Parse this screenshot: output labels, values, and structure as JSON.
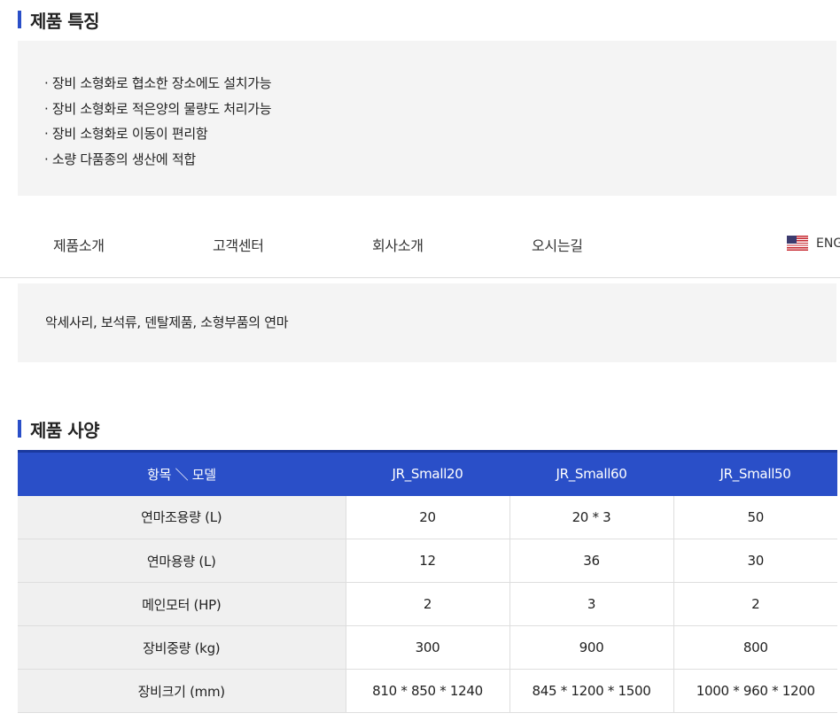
{
  "features": {
    "title": "제품 특징",
    "items": [
      "· 장비 소형화로 협소한 장소에도 설치가능",
      "· 장비 소형화로 적은양의 물량도 처리가능",
      "· 장비 소형화로 이동이 편리함",
      "· 소량 다품종의 생산에 적합"
    ]
  },
  "nav": {
    "items": [
      "제품소개",
      "고객센터",
      "회사소개",
      "오시는길"
    ],
    "language": "ENG"
  },
  "usage": {
    "text": "악세사리, 보석류, 덴탈제품, 소형부품의 연마"
  },
  "specs": {
    "title": "제품 사양",
    "header": [
      "항목 ＼ 모델",
      "JR_Small20",
      "JR_Small60",
      "JR_Small50"
    ],
    "rows": [
      [
        "연마조용량 (L)",
        "20",
        "20 * 3",
        "50"
      ],
      [
        "연마용량 (L)",
        "12",
        "36",
        "30"
      ],
      [
        "메인모터 (HP)",
        "2",
        "3",
        "2"
      ],
      [
        "장비중량 (kg)",
        "300",
        "900",
        "800"
      ],
      [
        "장비크기 (mm)",
        "810 * 850 * 1240",
        "845 * 1200 * 1500",
        "1000 * 960 * 1200"
      ]
    ]
  },
  "colors": {
    "accent": "#2a4fc8",
    "panel_bg": "#f4f4f4"
  }
}
